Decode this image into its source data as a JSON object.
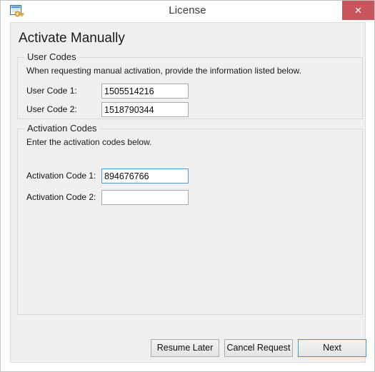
{
  "window": {
    "title": "License",
    "icon": "license-key-window-icon",
    "close_label": "✕",
    "accent_blue": "#4c9ed9",
    "close_red": "#c9545c"
  },
  "page": {
    "heading": "Activate Manually"
  },
  "user_codes_group": {
    "legend": "User Codes",
    "description": "When requesting manual activation, provide the information listed below.",
    "fields": [
      {
        "label": "User Code 1:",
        "value": "1505514216",
        "placeholder": "",
        "focused": false
      },
      {
        "label": "User Code 2:",
        "value": "1518790344",
        "placeholder": "",
        "focused": false
      }
    ]
  },
  "activation_codes_group": {
    "legend": "Activation Codes",
    "description": "Enter the activation codes below.",
    "fields": [
      {
        "label": "Activation Code 1:",
        "value": "894676766",
        "placeholder": "",
        "focused": true
      },
      {
        "label": "Activation Code 2:",
        "value": "",
        "placeholder": "",
        "focused": false
      }
    ]
  },
  "buttons": {
    "resume_later": "Resume Later",
    "cancel_request": "Cancel Request",
    "next": "Next"
  }
}
